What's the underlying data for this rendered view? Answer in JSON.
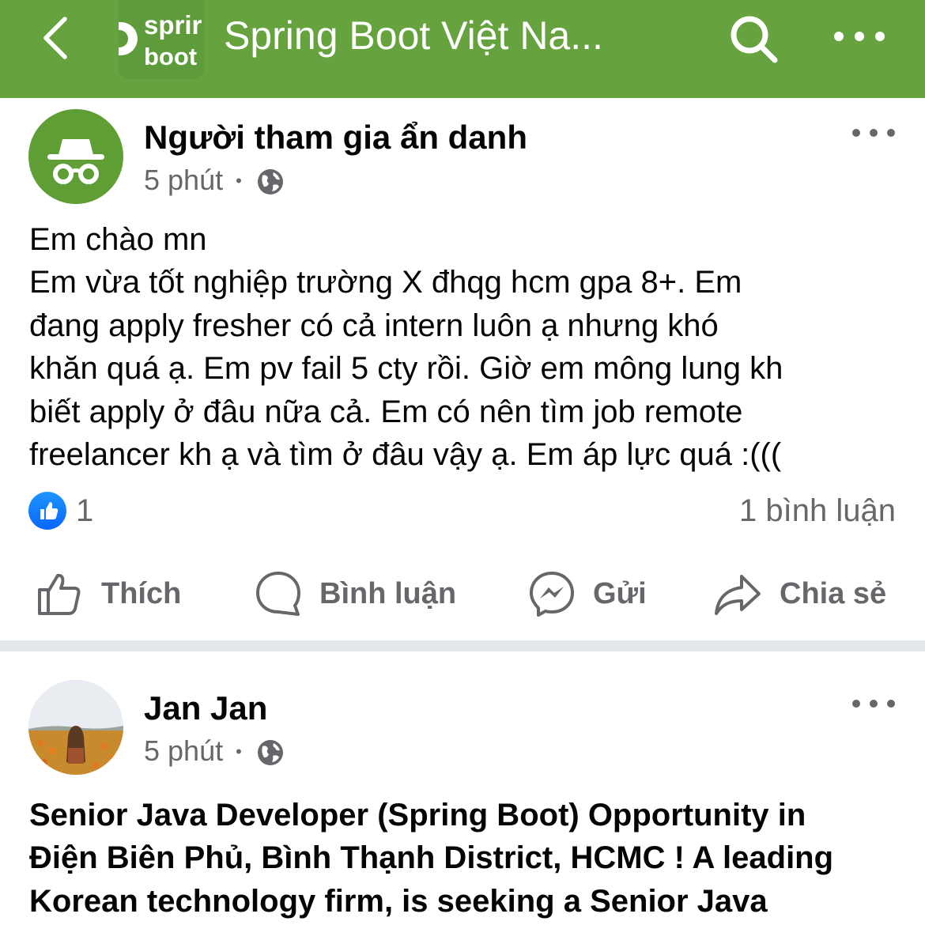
{
  "header": {
    "group_title": "Spring Boot Việt Na...",
    "logo_line1": "sprir",
    "logo_line2": "boot",
    "back_icon": "chevron-left-icon",
    "search_icon": "search-icon",
    "more_icon": "more-horizontal-icon",
    "color": "#66a33f"
  },
  "posts": [
    {
      "author": "Người tham gia ẩn danh",
      "time": "5 phút",
      "sep": "•",
      "avatar_icon": "incognito-icon",
      "lines": [
        "Em chào mn",
        "Em vừa tốt nghiệp trường X đhqg hcm gpa 8+. Em",
        "đang apply fresher có cả intern luôn ạ nhưng khó",
        "khăn quá ạ. Em pv fail 5 cty rồi. Giờ em mông lung kh",
        "biết apply ở đâu nữa cả. Em có nên tìm job remote",
        "freelancer kh ạ và tìm ở đâu vậy ạ. Em áp lực quá :((("
      ],
      "reaction_count": "1",
      "comment_count": "1 bình luận",
      "actions": {
        "like": "Thích",
        "comment": "Bình luận",
        "send": "Gửi",
        "share": "Chia sẻ"
      }
    },
    {
      "author": "Jan Jan",
      "time": "5 phút",
      "sep": "•",
      "lines": [
        "Senior Java Developer (Spring Boot) Opportunity in",
        "Điện Biên Phủ, Bình Thạnh District, HCMC ! A leading",
        "Korean technology firm, is seeking a Senior Java"
      ]
    }
  ]
}
